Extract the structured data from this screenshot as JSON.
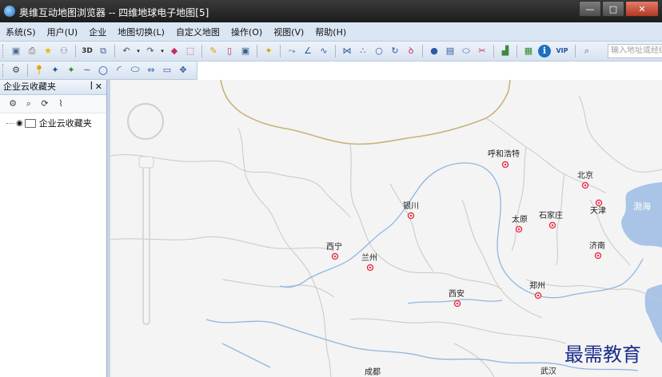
{
  "window": {
    "title": "奥维互动地图浏览器 -- 四维地球电子地图[5]"
  },
  "menu": {
    "items": [
      "系统(S)",
      "用户(U)",
      "企业",
      "地图切换(L)",
      "自定义地图",
      "操作(O)",
      "视图(V)",
      "帮助(H)"
    ]
  },
  "toolbar": {
    "btn_3d": "3D",
    "btn_vip": "VIP",
    "search_placeholder": "输入地址或经纬"
  },
  "panel": {
    "title": "企业云收藏夹",
    "pin": "ꟾ",
    "close": "✕",
    "tree_item": "企业云收藏夹"
  },
  "map": {
    "cities": [
      "呼和浩特",
      "北京",
      "银川",
      "太原",
      "石家庄",
      "天津",
      "西宁",
      "兰州",
      "济南",
      "郑州",
      "西安",
      "成都",
      "武汉"
    ],
    "sea_label": "渤海"
  },
  "watermark": "最需教育",
  "colors": {
    "accent": "#dbe6f4",
    "map_bg": "#f4f4f4",
    "sea": "#a9c4e6",
    "river": "#8fb6df",
    "city_marker": "#e4374a",
    "watermark": "#1a2c8c"
  }
}
